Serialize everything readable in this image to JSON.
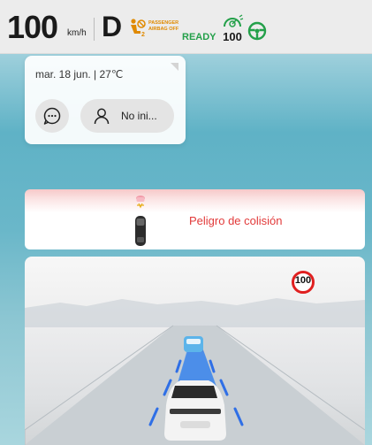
{
  "status": {
    "speed": "100",
    "speed_unit": "km/h",
    "gear": "D",
    "airbag_line1": "PASSENGER",
    "airbag_line2": "AIRBAG",
    "airbag_off": "OFF",
    "ready": "READY",
    "speed_limit": "100",
    "colors": {
      "ready": "#24a04a",
      "airbag": "#e08a00"
    },
    "icons": [
      "passenger-airbag-off-icon",
      "speed-limit-assist-icon",
      "steering-wheel-icon"
    ]
  },
  "info_card": {
    "date_temp": "mar. 18 jun. | 27℃",
    "user_label": "No ini...",
    "icons": [
      "chat-icon",
      "user-icon"
    ]
  },
  "alert": {
    "text": "Peligro de colisión",
    "color": "#e23a3a"
  },
  "lane_view": {
    "speed_sign": "100"
  }
}
